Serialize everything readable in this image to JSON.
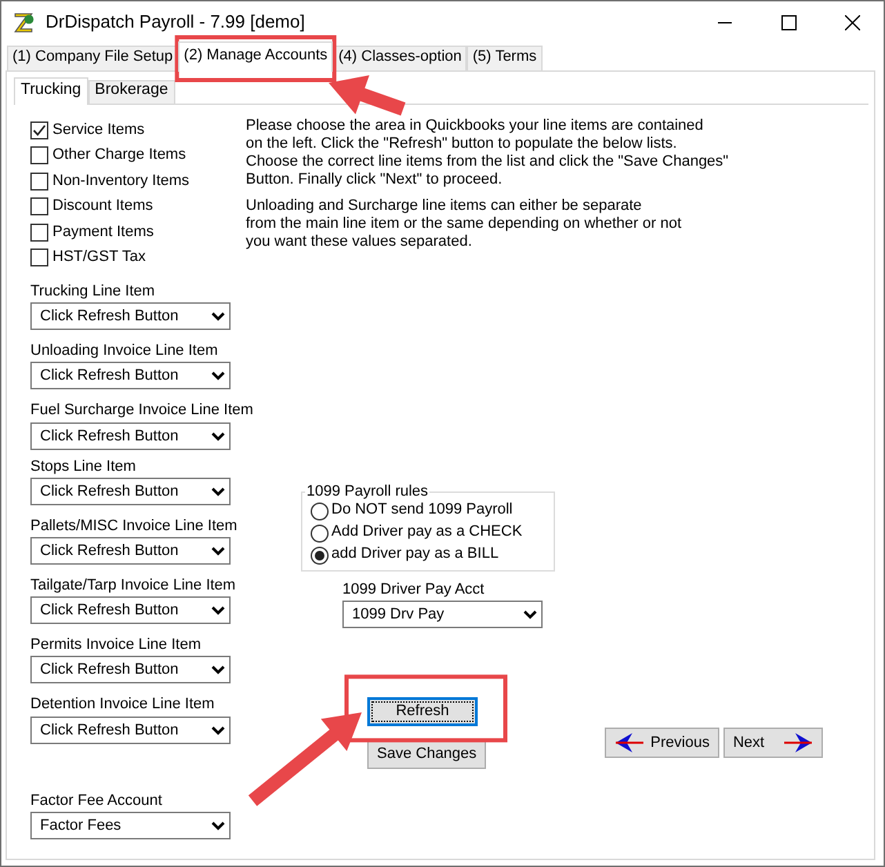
{
  "window": {
    "title": "DrDispatch Payroll - 7.99 [demo]"
  },
  "tabs": [
    {
      "label": "(1) Company File Setup",
      "selected": false
    },
    {
      "label": "(2) Manage Accounts",
      "selected": true
    },
    {
      "label": "(4) Classes-option",
      "selected": false
    },
    {
      "label": "(5) Terms",
      "selected": false
    }
  ],
  "subtabs": [
    {
      "label": "Trucking",
      "selected": true
    },
    {
      "label": "Brokerage",
      "selected": false
    }
  ],
  "item_types": [
    {
      "label": "Service Items",
      "checked": true
    },
    {
      "label": "Other Charge Items",
      "checked": false
    },
    {
      "label": "Non-Inventory Items",
      "checked": false
    },
    {
      "label": "Discount Items",
      "checked": false
    },
    {
      "label": "Payment Items",
      "checked": false
    },
    {
      "label": "HST/GST Tax",
      "checked": false
    }
  ],
  "line_items": [
    {
      "label": "Trucking Line Item",
      "value": "Click Refresh Button"
    },
    {
      "label": "Unloading Invoice Line Item",
      "value": "Click Refresh Button"
    },
    {
      "label": "Fuel Surcharge Invoice Line Item",
      "value": "Click Refresh Button"
    },
    {
      "label": "Stops Line Item",
      "value": "Click Refresh Button"
    },
    {
      "label": "Pallets/MISC Invoice Line Item",
      "value": "Click Refresh Button"
    },
    {
      "label": "Tailgate/Tarp Invoice Line Item",
      "value": "Click Refresh Button"
    },
    {
      "label": "Permits Invoice Line Item",
      "value": "Click Refresh Button"
    },
    {
      "label": "Detention Invoice Line Item",
      "value": "Click Refresh Button"
    }
  ],
  "factor_fee": {
    "label": "Factor Fee Account",
    "value": "Factor Fees"
  },
  "instructions": [
    [
      "Please choose the area in Quickbooks your line items are contained",
      "on the left.  Click the \"Refresh\" button to populate the below lists.",
      "Choose the correct line items from the list and click the \"Save Changes\"",
      "Button.  Finally click \"Next\" to proceed."
    ],
    [
      "Unloading and Surcharge line items can either be separate",
      "from the main line item or the same depending on whether or not",
      "you want these values separated."
    ]
  ],
  "payroll_rules": {
    "title": "1099 Payroll rules",
    "options": [
      {
        "label": "Do NOT send 1099 Payroll",
        "selected": false
      },
      {
        "label": "Add Driver pay as a CHECK",
        "selected": false
      },
      {
        "label": "add Driver pay as a BILL",
        "selected": true
      }
    ]
  },
  "driver_pay_acct": {
    "label": "1099 Driver Pay Acct",
    "value": "1099 Drv Pay"
  },
  "buttons": [
    {
      "kind": "refresh",
      "label": "Refresh",
      "focused": true
    },
    {
      "kind": "save",
      "label": "Save Changes",
      "focused": false
    },
    {
      "kind": "previous",
      "label": "Previous",
      "focused": false
    },
    {
      "kind": "next",
      "label": "Next",
      "focused": false
    }
  ]
}
